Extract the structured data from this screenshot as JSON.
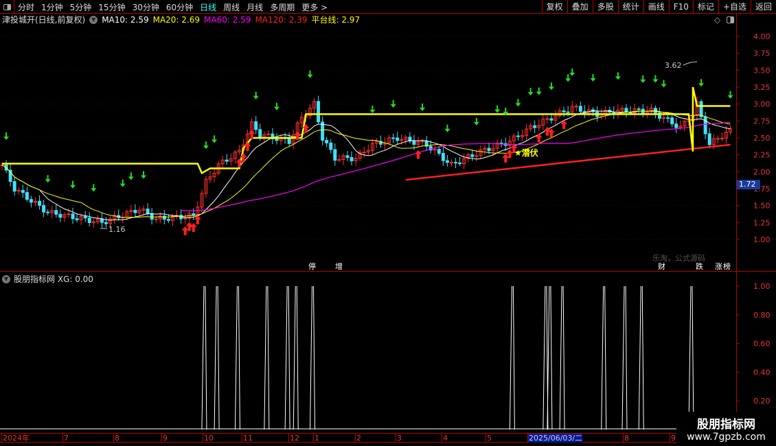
{
  "toolbar": {
    "periods": [
      "分时",
      "1分钟",
      "5分钟",
      "15分钟",
      "30分钟",
      "60分钟",
      "日线",
      "周线",
      "月线",
      "多周期",
      "更多 >"
    ],
    "active": "日线",
    "right": [
      "复权",
      "叠加",
      "多股",
      "统计",
      "画线",
      "F10",
      "标记",
      "+自选",
      "返回"
    ]
  },
  "legend": {
    "title": "津投城开(日线,前复权)",
    "ma10": "MA10: 2.59",
    "ma20": "MA20: 2.69",
    "ma60": "MA60: 2.59",
    "ma120": "MA120: 2.39",
    "platform": "平台线: 2.97"
  },
  "colors": {
    "ma10": "#ffffff",
    "ma20": "#ffff00",
    "ma60": "#ff00ff",
    "ma120": "#ff2020",
    "platform": "#ffff00",
    "up": "#ff3030",
    "down": "#40e0ff",
    "accent": "#bb0000"
  },
  "annotations": {
    "high": "3.62",
    "low": "1.16",
    "qianfu": "★潜伏",
    "watermark_faint": "乐淘，公式源码",
    "current_price": "1.72"
  },
  "tags": [
    {
      "t": "停",
      "c": "#008080"
    },
    {
      "t": "增",
      "c": "#8b0000"
    },
    {
      "t": "财",
      "c": "#0a3a7a"
    },
    {
      "t": "跌",
      "c": "#007a00"
    },
    {
      "t": "涨",
      "c": "#8b0000"
    },
    {
      "t": "榜",
      "c": "#a05000"
    }
  ],
  "indicator": {
    "title": "股朋指标网 XG: 0.00",
    "yticks": [
      "1.00",
      "0.80",
      "0.60",
      "0.40",
      "0.20"
    ]
  },
  "dates": [
    "2024年",
    "7",
    "8",
    "9",
    "10",
    "11",
    "12",
    "1",
    "2",
    "3",
    "4",
    "5",
    "2025/06/03/二",
    "8",
    "9"
  ],
  "watermark": {
    "name": "股朋指标网",
    "url": "www.7gpzb.com"
  },
  "chart_data": {
    "type": "candlestick",
    "bars": 176,
    "ylim": [
      0.75,
      4.2
    ],
    "yticks": [
      "4.00",
      "3.75",
      "3.50",
      "3.25",
      "3.00",
      "2.75",
      "2.50",
      "2.25",
      "2.00",
      "1.75",
      "1.50",
      "1.25",
      "1.00"
    ],
    "close_keypoints": [
      [
        0,
        2.1
      ],
      [
        3,
        1.75
      ],
      [
        11,
        1.4
      ],
      [
        24,
        1.25
      ],
      [
        33,
        1.45
      ],
      [
        37,
        1.3
      ],
      [
        46,
        1.35
      ],
      [
        49,
        1.85
      ],
      [
        52,
        2.1
      ],
      [
        57,
        2.3
      ],
      [
        60,
        2.7
      ],
      [
        62,
        2.55
      ],
      [
        69,
        2.45
      ],
      [
        72,
        2.8
      ],
      [
        75,
        3.0
      ],
      [
        77,
        2.5
      ],
      [
        80,
        2.2
      ],
      [
        85,
        2.2
      ],
      [
        89,
        2.4
      ],
      [
        95,
        2.5
      ],
      [
        102,
        2.4
      ],
      [
        108,
        2.1
      ],
      [
        115,
        2.3
      ],
      [
        122,
        2.45
      ],
      [
        127,
        2.65
      ],
      [
        132,
        2.8
      ],
      [
        137,
        2.95
      ],
      [
        143,
        2.85
      ],
      [
        148,
        2.9
      ],
      [
        156,
        2.9
      ],
      [
        163,
        2.65
      ],
      [
        166,
        2.85
      ],
      [
        167,
        3.0
      ],
      [
        170,
        2.4
      ],
      [
        172,
        2.5
      ],
      [
        175,
        2.6
      ]
    ],
    "platform_line": [
      [
        0,
        2.12
      ],
      [
        47,
        2.12
      ],
      [
        48,
        1.98
      ],
      [
        50,
        2.05
      ],
      [
        57,
        2.05
      ],
      [
        58,
        2.35
      ],
      [
        60,
        2.5
      ],
      [
        72,
        2.5
      ],
      [
        73,
        2.85
      ],
      [
        165,
        2.85
      ],
      [
        166,
        2.3
      ],
      [
        166,
        3.25
      ],
      [
        167,
        2.97
      ],
      [
        175,
        2.97
      ]
    ],
    "red_line": [
      [
        97,
        1.88
      ],
      [
        175,
        2.4
      ]
    ],
    "sell_signals": [
      1,
      11,
      17,
      22,
      29,
      31,
      34,
      49,
      51,
      61,
      66,
      74,
      89,
      94,
      101,
      107,
      114,
      119,
      121,
      124,
      127,
      129,
      132,
      136,
      137,
      142,
      148,
      154,
      157,
      159,
      168,
      175
    ],
    "buy_signals": [
      44,
      45,
      46,
      47,
      57,
      58,
      59,
      60,
      71,
      73,
      100,
      121,
      122,
      123,
      129,
      131,
      132,
      135
    ],
    "xg_signal_bars": [
      49,
      52,
      57,
      64,
      69,
      71,
      75,
      123,
      131,
      132,
      135,
      145,
      150,
      154,
      166
    ]
  }
}
